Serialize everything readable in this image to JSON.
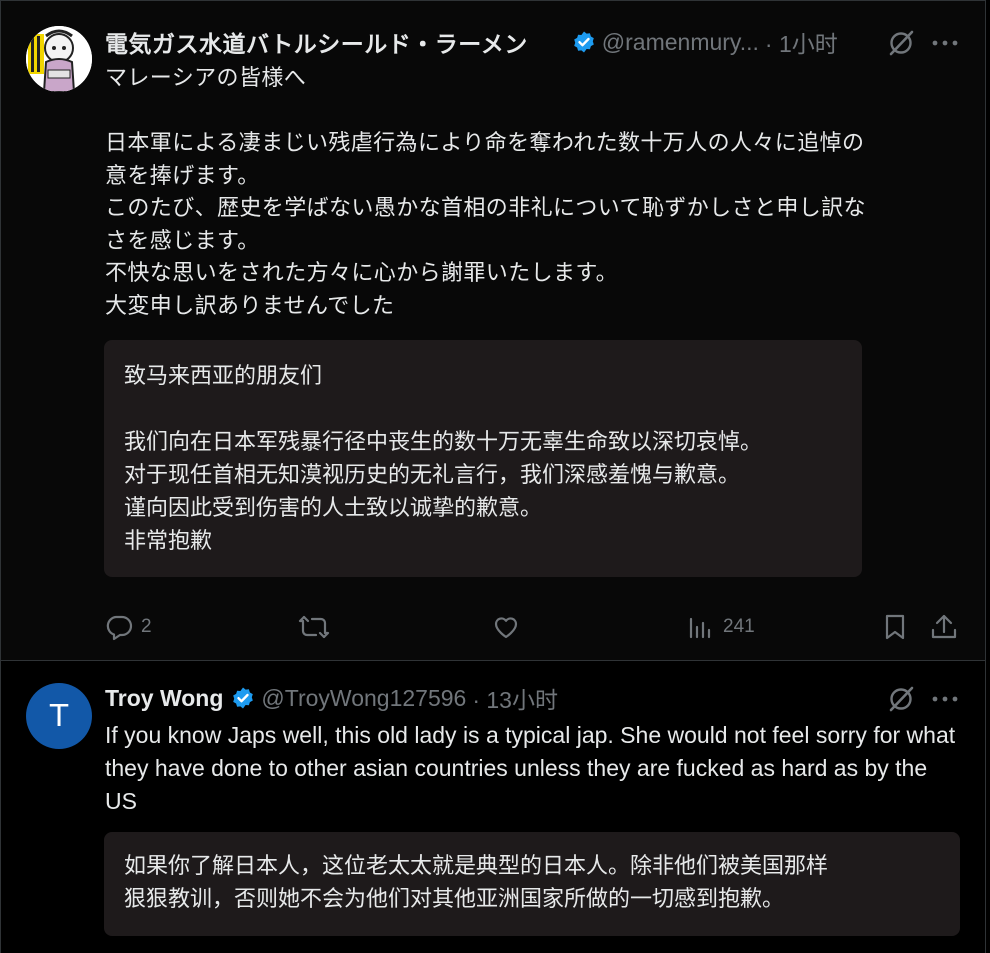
{
  "tweet1": {
    "display_name": "電気ガス水道バトルシールド・ラーメン",
    "handle": "@ramenmury...",
    "time": "· 1小时",
    "lines": "マレーシアの皆様へ\n\n日本軍による凄まじい残虐行為により命を奪われた数十万人の人々に追悼の\n意を捧げます。\nこのたび、歴史を学ばない愚かな首相の非礼について恥ずかしさと申し訳な\nさを感じます。\n不快な思いをされた方々に心から謝罪いたします。\n大変申し訳ありませんでした",
    "translation": "致马来西亚的朋友们\n\n我们向在日本军残暴行径中丧生的数十万无辜生命致以深切哀悼。\n对于现任首相无知漠视历史的无礼言行，我们深感羞愧与歉意。\n谨向因此受到伤害的人士致以诚挚的歉意。\n非常抱歉",
    "actions": {
      "replies": "2",
      "views": "241"
    }
  },
  "tweet2": {
    "avatar_letter": "T",
    "display_name": "Troy Wong",
    "handle": "@TroyWong127596",
    "time": "· 13小时",
    "text": "If you know Japs well, this old lady is a typical jap. She would not feel sorry for what they have done to other asian countries unless they are fucked as hard as by the US",
    "translation": "如果你了解日本人，这位老太太就是典型的日本人。除非他们被美国那样\n狠狠教训，否则她不会为他们对其他亚洲国家所做的一切感到抱歉。"
  },
  "colors": {
    "background": "#000000",
    "text": "#e7e9ea",
    "muted": "#71767b",
    "verified": "#1d9bf0",
    "translation_bg": "#1e1a1b",
    "avatar2_bg": "#1258a8"
  },
  "icons": [
    "verified-badge-icon",
    "grok-icon",
    "more-icon",
    "reply-icon",
    "retweet-icon",
    "like-icon",
    "views-icon",
    "bookmark-icon",
    "share-icon"
  ]
}
